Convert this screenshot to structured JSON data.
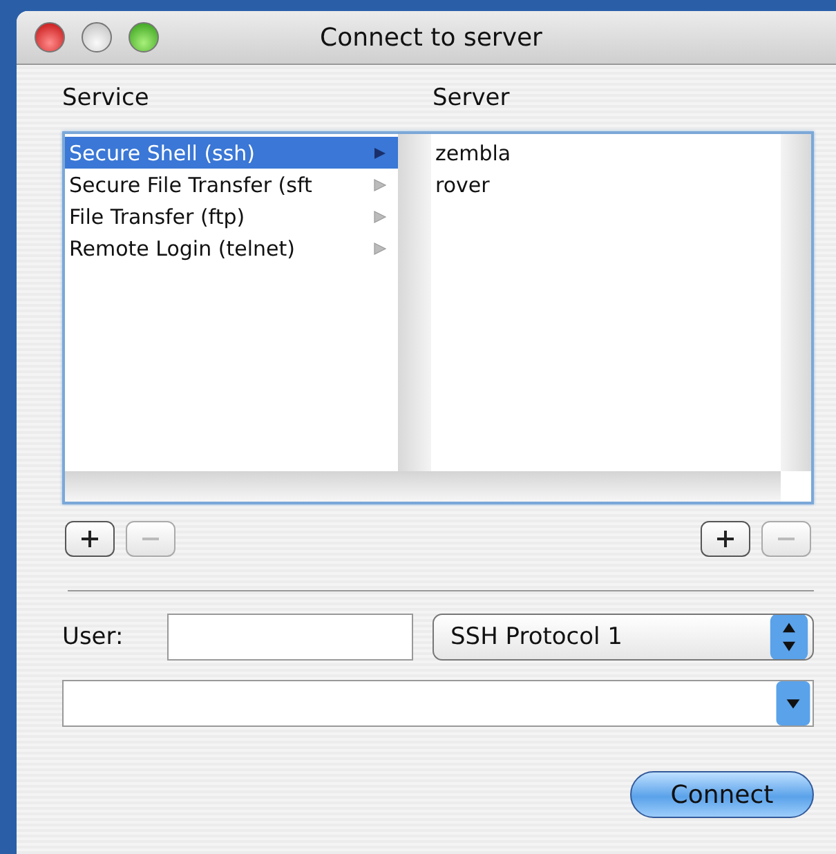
{
  "window": {
    "title": "Connect to server"
  },
  "service": {
    "heading": "Service",
    "items": [
      {
        "label": "Secure Shell (ssh)",
        "selected": true
      },
      {
        "label": "Secure File Transfer (sft",
        "selected": false
      },
      {
        "label": "File Transfer (ftp)",
        "selected": false
      },
      {
        "label": "Remote Login (telnet)",
        "selected": false
      }
    ],
    "buttons": [
      {
        "kind": "add",
        "disabled": false
      },
      {
        "kind": "remove",
        "disabled": true
      }
    ]
  },
  "server": {
    "heading": "Server",
    "items": [
      {
        "label": "zembla",
        "selected": false
      },
      {
        "label": "rover",
        "selected": false
      }
    ],
    "buttons": [
      {
        "kind": "add",
        "disabled": false
      },
      {
        "kind": "remove",
        "disabled": true
      }
    ]
  },
  "user": {
    "label": "User:"
  },
  "protocol": {
    "value": "SSH Protocol 1"
  },
  "connect_button": {
    "label": "Connect"
  }
}
